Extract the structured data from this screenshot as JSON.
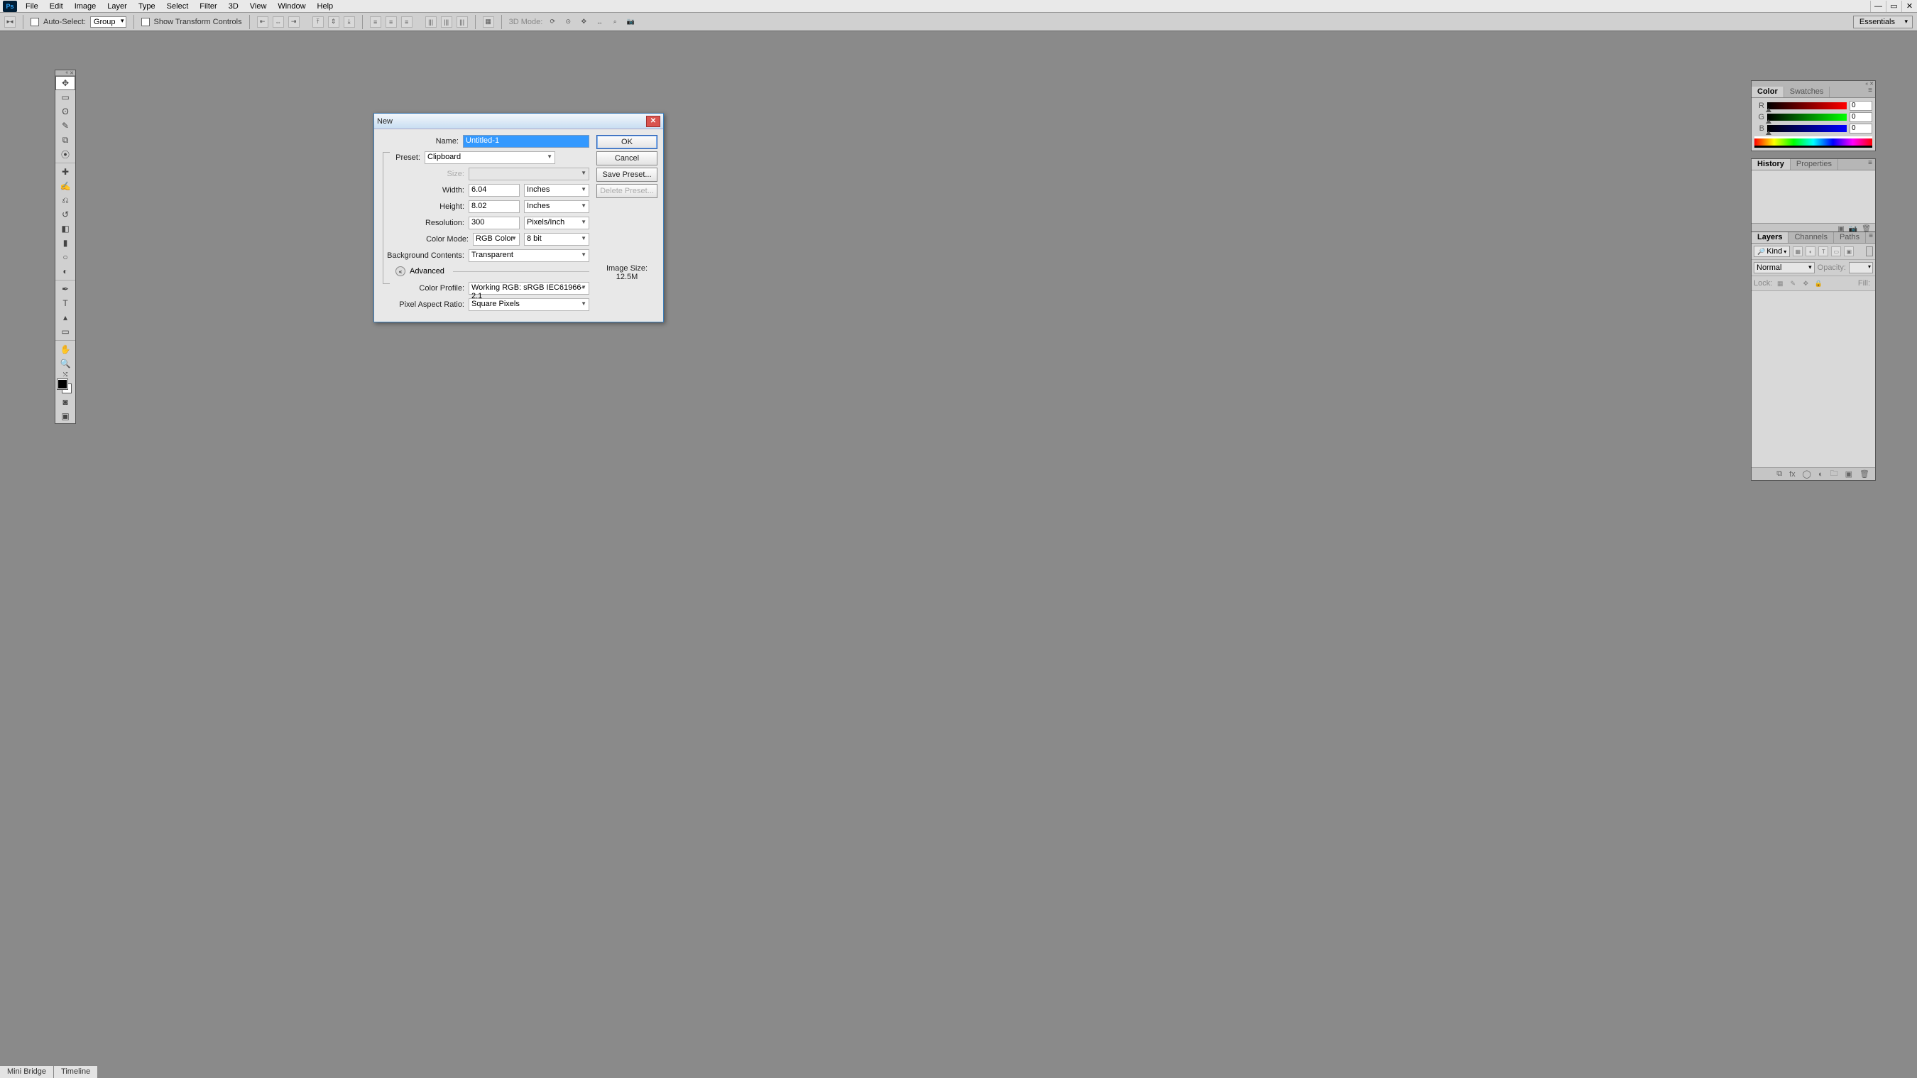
{
  "app_logo": "Ps",
  "menus": [
    "File",
    "Edit",
    "Image",
    "Layer",
    "Type",
    "Select",
    "Filter",
    "3D",
    "View",
    "Window",
    "Help"
  ],
  "optionsbar": {
    "auto_select_label": "Auto-Select:",
    "group_value": "Group",
    "show_transform_label": "Show Transform Controls",
    "mode_3d_label": "3D Mode:"
  },
  "workspace_label": "Essentials",
  "dialog": {
    "title": "New",
    "name_label": "Name:",
    "name_value": "Untitled-1",
    "preset_label": "Preset:",
    "preset_value": "Clipboard",
    "size_label": "Size:",
    "size_value": "",
    "width_label": "Width:",
    "width_value": "6.04",
    "width_unit": "Inches",
    "height_label": "Height:",
    "height_value": "8.02",
    "height_unit": "Inches",
    "resolution_label": "Resolution:",
    "resolution_value": "300",
    "resolution_unit": "Pixels/Inch",
    "colormode_label": "Color Mode:",
    "colormode_value": "RGB Color",
    "colormode_depth": "8 bit",
    "bgcontents_label": "Background Contents:",
    "bgcontents_value": "Transparent",
    "advanced_label": "Advanced",
    "colorprofile_label": "Color Profile:",
    "colorprofile_value": "Working RGB:  sRGB IEC61966-2.1",
    "pixelaspect_label": "Pixel Aspect Ratio:",
    "pixelaspect_value": "Square Pixels",
    "btn_ok": "OK",
    "btn_cancel": "Cancel",
    "btn_save_preset": "Save Preset...",
    "btn_delete_preset": "Delete Preset...",
    "image_size_label": "Image Size:",
    "image_size_value": "12.5M"
  },
  "color_panel": {
    "tabs": [
      "Color",
      "Swatches"
    ],
    "channels": {
      "r_label": "R",
      "g_label": "G",
      "b_label": "B",
      "r_val": "0",
      "g_val": "0",
      "b_val": "0"
    }
  },
  "history_panel": {
    "tabs": [
      "History",
      "Properties"
    ]
  },
  "layers_panel": {
    "tabs": [
      "Layers",
      "Channels",
      "Paths"
    ],
    "kind_label": "Kind",
    "blend_mode": "Normal",
    "opacity_label": "Opacity:",
    "lock_label": "Lock:",
    "fill_label": "Fill:"
  },
  "bottom_tabs": [
    "Mini Bridge",
    "Timeline"
  ]
}
